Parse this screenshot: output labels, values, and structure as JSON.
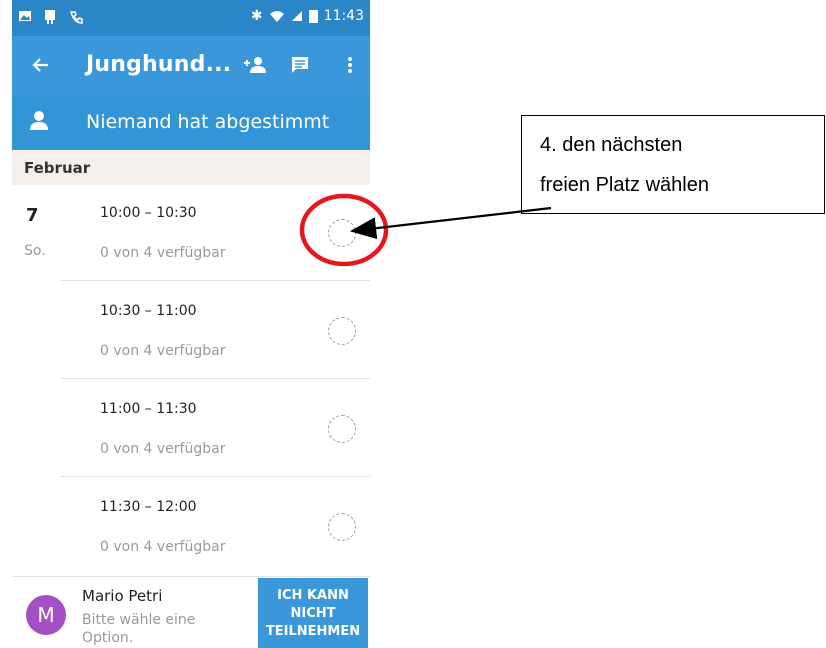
{
  "status_bar": {
    "time": "11:43"
  },
  "toolbar": {
    "title": "Junghund...",
    "icons": [
      "arrow-back-icon",
      "add-person-icon",
      "chat-icon",
      "more-vert-icon"
    ]
  },
  "votes_banner": {
    "text": "Niemand hat abgestimmt",
    "icon": "person-icon"
  },
  "month_label": "Februar",
  "day": {
    "number": "7",
    "weekday": "So."
  },
  "slots": [
    {
      "time": "10:00 – 10:30",
      "availability": "0 von 4 verfügbar"
    },
    {
      "time": "10:30 – 11:00",
      "availability": "0 von 4 verfügbar"
    },
    {
      "time": "11:00 – 11:30",
      "availability": "0 von 4 verfügbar"
    },
    {
      "time": "11:30 – 12:00",
      "availability": "0 von 4 verfügbar"
    }
  ],
  "footer": {
    "avatar_letter": "M",
    "user_name": "Mario Petri",
    "hint": "Bitte wähle eine Option.",
    "cant_button": "ICH KANN\nNICHT\nTEILNEHMEN"
  },
  "annotation": {
    "line1": "4. den nächsten",
    "line2": "freien Platz wählen",
    "highlight_color": "#e8151b",
    "arrow_color": "#000000"
  },
  "colors": {
    "status_bar": "#2a86c7",
    "toolbar": "#3a98da",
    "accent": "#3394d6",
    "avatar": "#a54fc4"
  }
}
